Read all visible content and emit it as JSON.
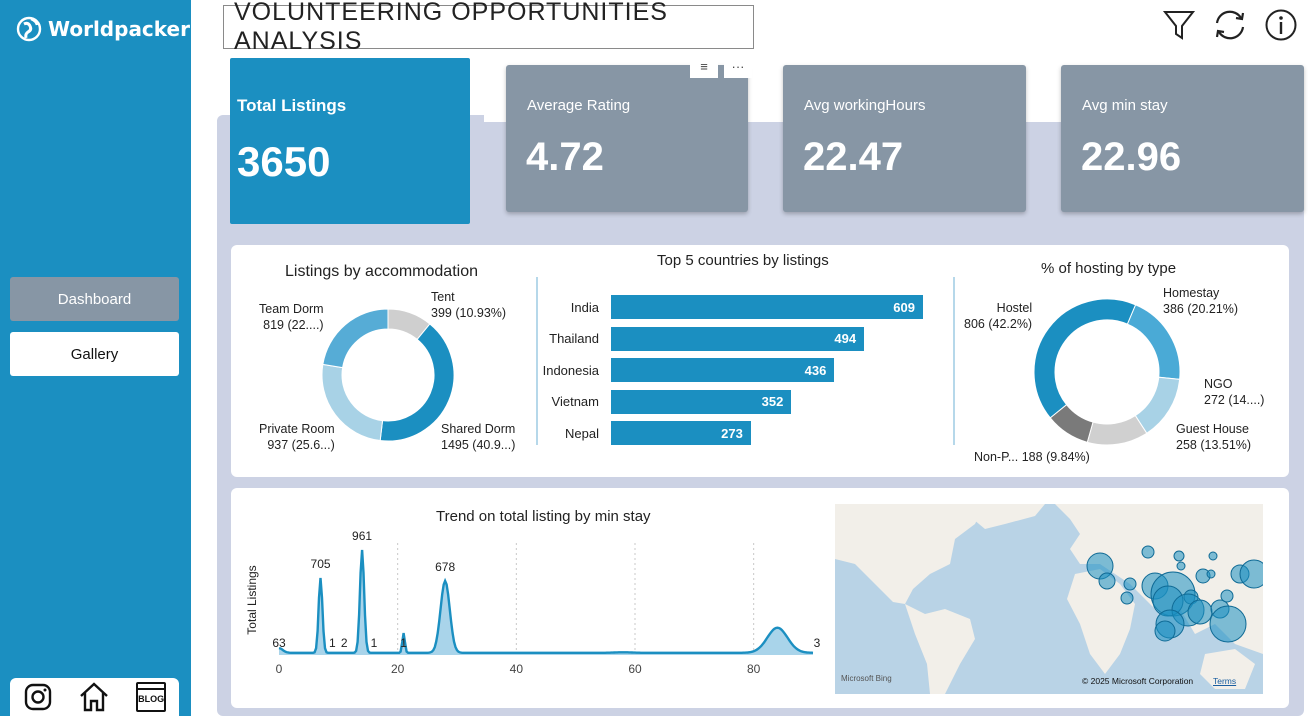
{
  "brand": {
    "name": "Worldpackers"
  },
  "nav": {
    "dashboard": "Dashboard",
    "gallery": "Gallery"
  },
  "social": {
    "instagram": "instagram-icon",
    "home": "home-icon",
    "blog": "BLOG"
  },
  "header": {
    "title": "VOLUNTEERING  OPPORTUNITIES  ANALYSIS"
  },
  "header_icons": [
    "filter-icon",
    "refresh-icon",
    "info-icon"
  ],
  "visual_header": {
    "filter": "≡",
    "more": "···"
  },
  "kpis": {
    "total_listings": {
      "label": "Total Listings",
      "value": "3650"
    },
    "avg_rating": {
      "label": "Average Rating",
      "value": "4.72"
    },
    "avg_hours": {
      "label": "Avg workingHours",
      "value": "22.47"
    },
    "avg_stay": {
      "label": "Avg min stay",
      "value": "22.96"
    }
  },
  "colors": {
    "primary": "#1b8fc1",
    "kpi_grey": "#8796a5",
    "canvas": "#ccd2e4"
  },
  "chart_data": [
    {
      "type": "pie",
      "title": "Listings by accommodation",
      "slices": [
        {
          "label": "Tent",
          "value": 399,
          "display": "399 (10.93%)",
          "color": "#cfcfcf"
        },
        {
          "label": "Shared Dorm",
          "value": 1495,
          "display": "1495 (40.9...)",
          "color": "#1b8fc1"
        },
        {
          "label": "Private Room",
          "value": 937,
          "display": "937 (25.6...)",
          "color": "#a8d2e6"
        },
        {
          "label": "Team Dorm",
          "value": 819,
          "display": "819 (22....)",
          "color": "#56acd6"
        }
      ]
    },
    {
      "type": "bar",
      "title": "Top 5 countries by listings",
      "categories": [
        "India",
        "Thailand",
        "Indonesia",
        "Vietnam",
        "Nepal"
      ],
      "values": [
        609,
        494,
        436,
        352,
        273
      ]
    },
    {
      "type": "pie",
      "title": "% of hosting by type",
      "slices": [
        {
          "label": "Homestay",
          "value": 386,
          "display": "386 (20.21%)",
          "color": "#4aaad6"
        },
        {
          "label": "NGO",
          "value": 272,
          "display": "272 (14....)",
          "color": "#a8d2e6"
        },
        {
          "label": "Guest House",
          "value": 258,
          "display": "258 (13.51%)",
          "color": "#d0d0d0"
        },
        {
          "label": "Non-P...",
          "value": 188,
          "display": "188 (9.84%)",
          "color": "#7a7a7a"
        },
        {
          "label": "Hostel",
          "value": 806,
          "display": "806 (42.2%)",
          "color": "#1b8fc1"
        }
      ]
    },
    {
      "type": "area",
      "title": "Trend on  total listing by min stay",
      "ylabel": "Total Listings",
      "xlabel": "",
      "xlim": [
        0,
        90
      ],
      "xticks": [
        0,
        20,
        40,
        60,
        80
      ],
      "points": [
        [
          0,
          63
        ],
        [
          7,
          705
        ],
        [
          9,
          1
        ],
        [
          11,
          2
        ],
        [
          14,
          961
        ],
        [
          16,
          1
        ],
        [
          21,
          1
        ],
        [
          28,
          678
        ],
        [
          90,
          3
        ]
      ],
      "labels": [
        {
          "x": 0,
          "y": 63,
          "text": "63"
        },
        {
          "x": 7,
          "y": 705,
          "text": "705"
        },
        {
          "x": 9,
          "y": 1,
          "text": "1"
        },
        {
          "x": 11,
          "y": 2,
          "text": "2"
        },
        {
          "x": 14,
          "y": 961,
          "text": "961"
        },
        {
          "x": 16,
          "y": 1,
          "text": "1"
        },
        {
          "x": 21,
          "y": 1,
          "text": "1"
        },
        {
          "x": 28,
          "y": 678,
          "text": "678"
        },
        {
          "x": 90,
          "y": 3,
          "text": "3"
        }
      ]
    }
  ],
  "map": {
    "attribution": "© 2025 Microsoft Corporation",
    "terms": "Terms",
    "provider": "Microsoft Bing"
  }
}
